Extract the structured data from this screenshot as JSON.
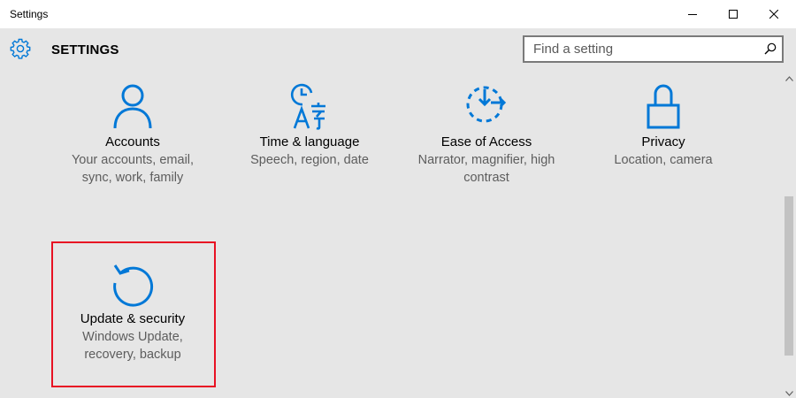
{
  "window": {
    "title": "Settings"
  },
  "header": {
    "heading": "SETTINGS",
    "search_placeholder": "Find a setting"
  },
  "tiles": [
    {
      "icon": "person-icon",
      "name": "Accounts",
      "desc": "Your accounts, email, sync, work, family"
    },
    {
      "icon": "time-language-icon",
      "name": "Time & language",
      "desc": "Speech, region, date"
    },
    {
      "icon": "ease-of-access-icon",
      "name": "Ease of Access",
      "desc": "Narrator, magnifier, high contrast"
    },
    {
      "icon": "lock-icon",
      "name": "Privacy",
      "desc": "Location, camera"
    },
    {
      "icon": "update-refresh-icon",
      "name": "Update & security",
      "desc": "Windows Update, recovery, backup"
    }
  ],
  "colors": {
    "accent": "#0078d7",
    "highlight": "#e81123",
    "background": "#e6e6e6"
  }
}
